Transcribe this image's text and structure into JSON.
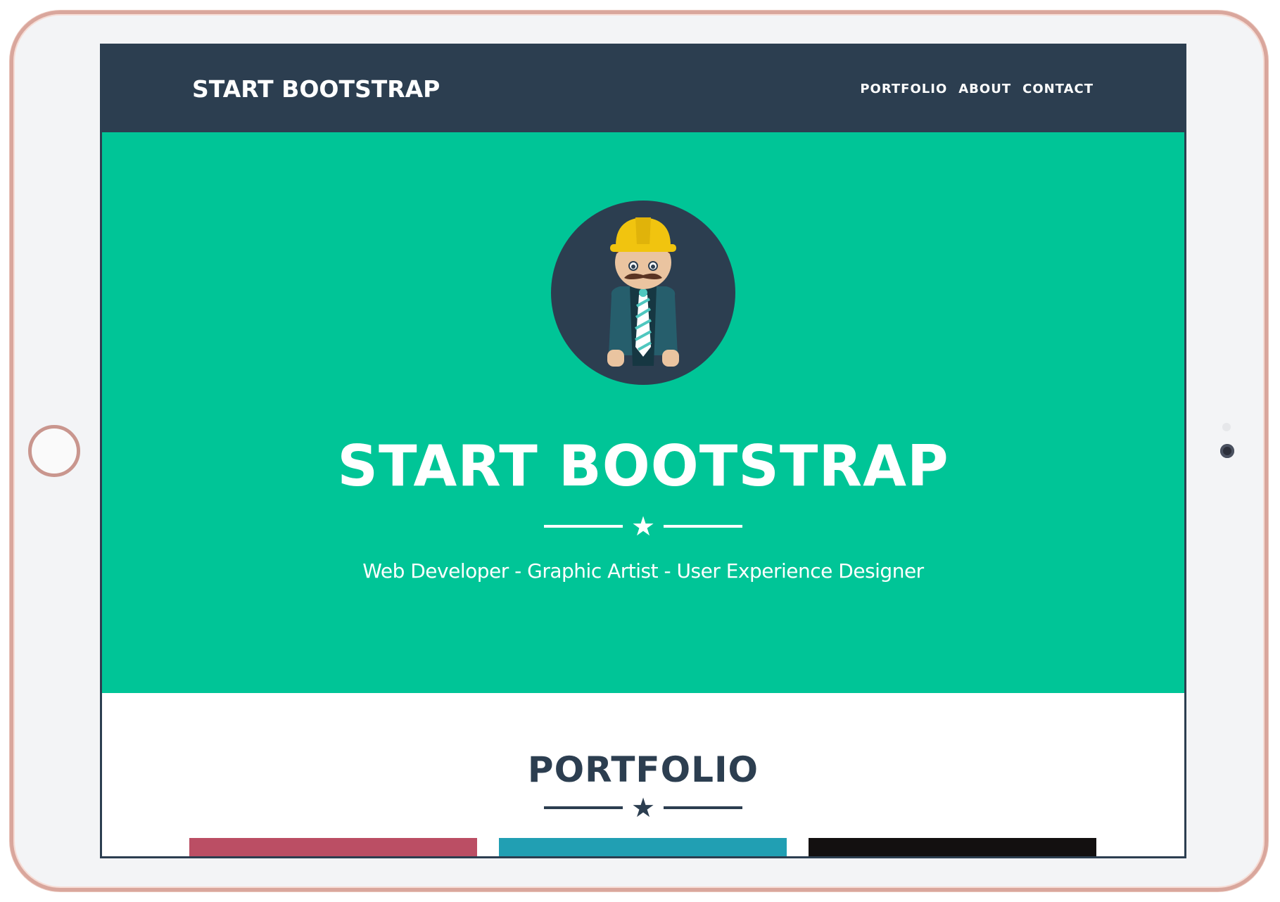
{
  "navbar": {
    "brand": "START BOOTSTRAP",
    "links": [
      "PORTFOLIO",
      "ABOUT",
      "CONTACT"
    ]
  },
  "masthead": {
    "avatar_icon": "construction-worker-avatar-icon",
    "title": "START BOOTSTRAP",
    "divider_icon": "star-icon",
    "subtitle": "Web Developer - Graphic Artist - User Experience Designer"
  },
  "portfolio": {
    "title": "PORTFOLIO",
    "divider_icon": "star-icon",
    "tile_colors": [
      "#bb4e64",
      "#219fb3",
      "#131010"
    ]
  },
  "colors": {
    "primary_dark": "#2c3e50",
    "accent_teal": "#00c597",
    "white": "#ffffff"
  }
}
